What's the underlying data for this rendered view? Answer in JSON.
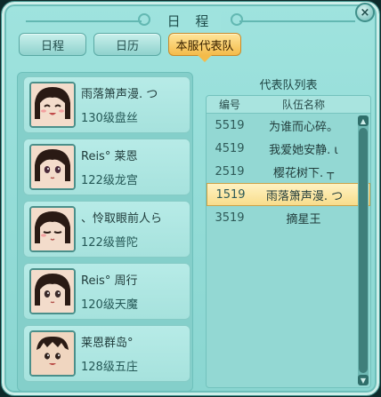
{
  "window": {
    "title": "日 程",
    "close_glyph": "×"
  },
  "tabs": [
    {
      "label": "日程",
      "active": false
    },
    {
      "label": "日历",
      "active": false
    },
    {
      "label": "本服代表队",
      "active": true
    }
  ],
  "members": [
    {
      "name": "雨落箫声漫. つ",
      "level": "130级盘丝",
      "avatar": "smiling-girl-avatar"
    },
    {
      "name": "Reis° 莱恩",
      "level": "122级龙宫",
      "avatar": "girl-avatar"
    },
    {
      "name": "、怜取眼前人ら",
      "level": "122级普陀",
      "avatar": "winking-girl-avatar"
    },
    {
      "name": "Reis° 周行",
      "level": "120级天魔",
      "avatar": "girl-avatar"
    },
    {
      "name": "莱恩群岛°",
      "level": "128级五庄",
      "avatar": "boy-avatar"
    }
  ],
  "team_list": {
    "title": "代表队列表",
    "columns": {
      "code": "编号",
      "name": "队伍名称"
    },
    "rows": [
      {
        "code": "5519",
        "name": "为谁而心碎。",
        "selected": false
      },
      {
        "code": "4519",
        "name": "我爱她安静. ι",
        "selected": false
      },
      {
        "code": "2519",
        "name": "樱花树下. ┬",
        "selected": false
      },
      {
        "code": "1519",
        "name": "雨落箫声漫. つ",
        "selected": true
      },
      {
        "code": "3519",
        "name": "摘星王",
        "selected": false
      }
    ]
  },
  "colors": {
    "accent": "#f4bb4a",
    "panel": "#9fe3de",
    "selected_row": "#f8dd8c"
  }
}
